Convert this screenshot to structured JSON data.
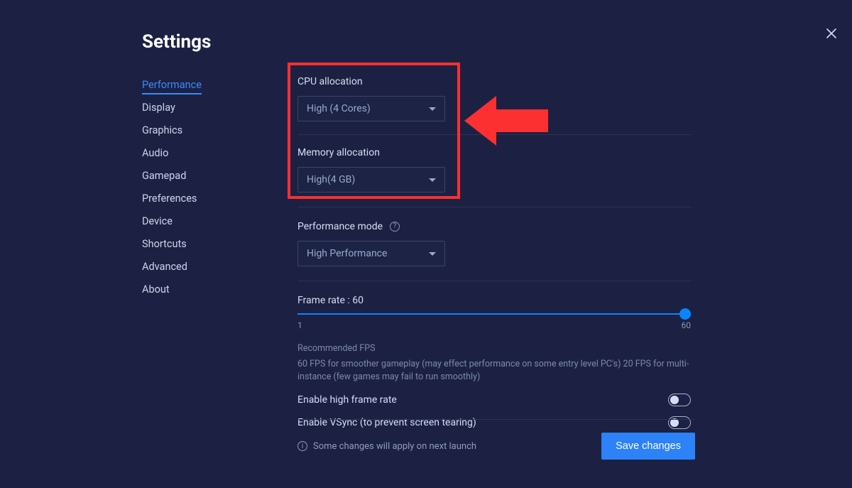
{
  "title": "Settings",
  "sidebar": {
    "items": [
      {
        "label": "Performance",
        "active": true
      },
      {
        "label": "Display"
      },
      {
        "label": "Graphics"
      },
      {
        "label": "Audio"
      },
      {
        "label": "Gamepad"
      },
      {
        "label": "Preferences"
      },
      {
        "label": "Device"
      },
      {
        "label": "Shortcuts"
      },
      {
        "label": "Advanced"
      },
      {
        "label": "About"
      }
    ]
  },
  "cpu": {
    "label": "CPU allocation",
    "value": "High (4 Cores)"
  },
  "memory": {
    "label": "Memory allocation",
    "value": "High(4 GB)"
  },
  "perfmode": {
    "label": "Performance mode",
    "value": "High Performance"
  },
  "framerate": {
    "label_prefix": "Frame rate : ",
    "value": "60",
    "min": "1",
    "max": "60"
  },
  "reco": {
    "title": "Recommended FPS",
    "text": "60 FPS for smoother gameplay (may effect performance on some entry level PC's) 20 FPS for multi-instance (few games may fail to run smoothly)"
  },
  "toggles": {
    "high_fps": "Enable high frame rate",
    "vsync": "Enable VSync (to prevent screen tearing)"
  },
  "footer": {
    "info": "Some changes will apply on next launch",
    "save": "Save changes"
  }
}
